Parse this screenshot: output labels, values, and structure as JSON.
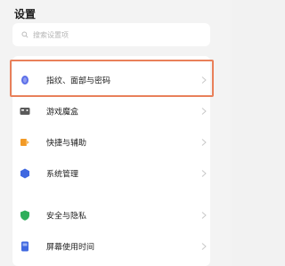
{
  "header": {
    "title": "设置"
  },
  "search": {
    "placeholder": "搜索设置项"
  },
  "settings_groups": [
    {
      "items": [
        {
          "label": "指纹、面部与密码",
          "icon": "fingerprint-lock-icon",
          "color": "#5b6ee8"
        },
        {
          "label": "游戏魔盒",
          "icon": "game-box-icon",
          "color": "#5a5a5a"
        },
        {
          "label": "快捷与辅助",
          "icon": "shortcut-assist-icon",
          "color": "#f29a26"
        },
        {
          "label": "系统管理",
          "icon": "system-management-icon",
          "color": "#3f68e0"
        }
      ]
    },
    {
      "items": [
        {
          "label": "安全与隐私",
          "icon": "shield-icon",
          "color": "#2fae5a"
        },
        {
          "label": "屏幕使用时间",
          "icon": "screen-time-icon",
          "color": "#3f68e0"
        }
      ]
    }
  ],
  "highlight_color": "#e9805a"
}
